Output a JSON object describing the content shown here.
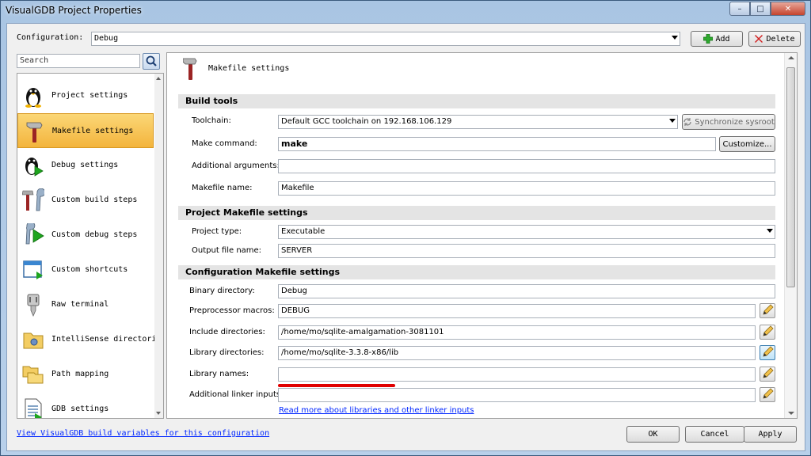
{
  "window": {
    "title": "VisualGDB Project Properties",
    "accent": "#f3b43c"
  },
  "config": {
    "label": "Configuration:",
    "value": "Debug",
    "add_label": "Add",
    "delete_label": "Delete"
  },
  "search": {
    "placeholder": "Search"
  },
  "nav": [
    {
      "label": "Project settings",
      "icon": "linux-penguin-icon"
    },
    {
      "label": "Makefile settings",
      "icon": "hammer-icon",
      "selected": true
    },
    {
      "label": "Debug settings",
      "icon": "debug-penguin-icon"
    },
    {
      "label": "Custom build steps",
      "icon": "tools-icon"
    },
    {
      "label": "Custom debug steps",
      "icon": "wrench-play-icon"
    },
    {
      "label": "Custom shortcuts",
      "icon": "shortcut-window-icon"
    },
    {
      "label": "Raw terminal",
      "icon": "plug-icon"
    },
    {
      "label": "IntelliSense directories",
      "icon": "folder-gear-icon"
    },
    {
      "label": "Path mapping",
      "icon": "folders-icon"
    },
    {
      "label": "GDB settings",
      "icon": "document-icon"
    }
  ],
  "page": {
    "title": "Makefile settings"
  },
  "build_tools": {
    "header": "Build tools",
    "toolchain_label": "Toolchain:",
    "toolchain_value": "Default GCC toolchain on 192.168.106.129",
    "sync_label": "Synchronize sysroot",
    "make_label": "Make command:",
    "make_value": "make",
    "customize_label": "Customize...",
    "args_label": "Additional arguments:",
    "args_value": "",
    "makefile_label": "Makefile name:",
    "makefile_value": "Makefile"
  },
  "project_makefile": {
    "header": "Project Makefile settings",
    "type_label": "Project type:",
    "type_value": "Executable",
    "output_label": "Output file name:",
    "output_value": "SERVER"
  },
  "config_makefile": {
    "header": "Configuration Makefile settings",
    "bin_label": "Binary directory:",
    "bin_value": "Debug",
    "macros_label": "Preprocessor macros:",
    "macros_value": "DEBUG",
    "include_label": "Include directories:",
    "include_value": "/home/mo/sqlite-amalgamation-3081101",
    "libdir_label": "Library directories:",
    "libdir_value": "/home/mo/sqlite-3.3.8-x86/lib",
    "libnames_label": "Library names:",
    "libnames_value": "",
    "linker_label": "Additional linker inputs:",
    "linker_value": "",
    "link_label": "Read more about libraries and other linker inputs"
  },
  "footer": {
    "link_label": "View VisualGDB build variables for this configuration",
    "ok_label": "OK",
    "cancel_label": "Cancel",
    "apply_label": "Apply"
  }
}
